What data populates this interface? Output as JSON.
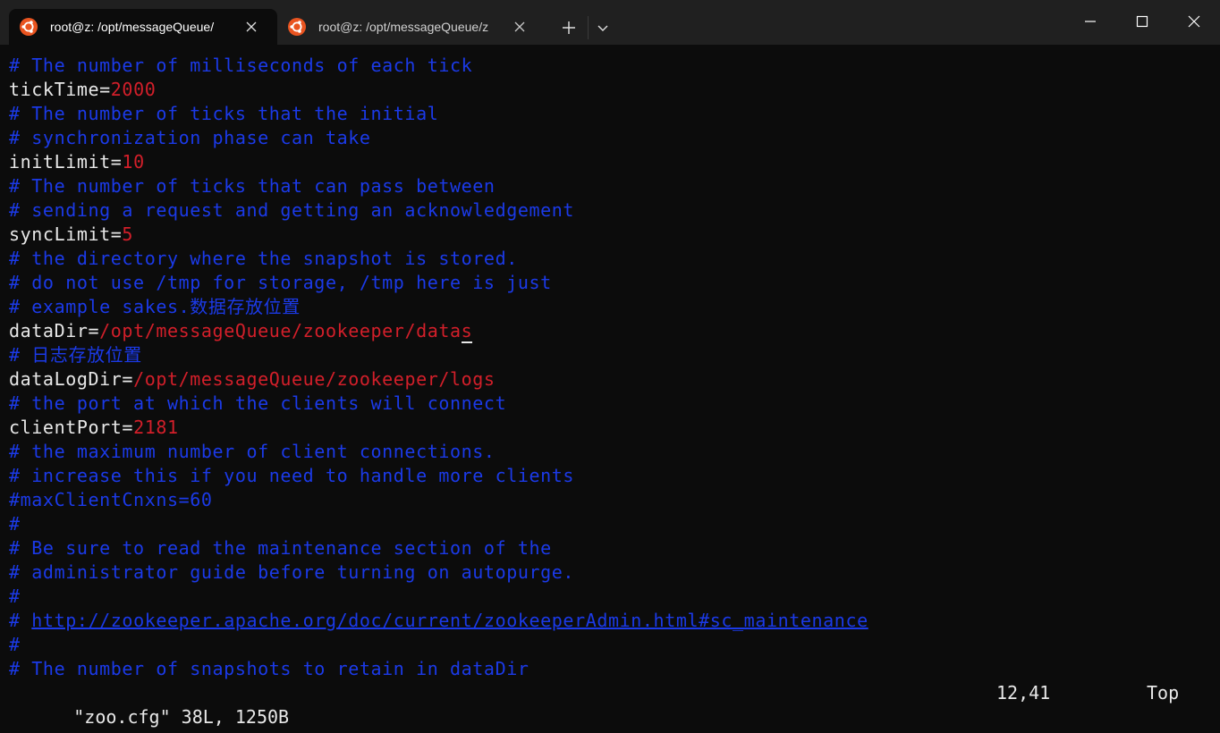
{
  "tabs": [
    {
      "label": "root@z: /opt/messageQueue/"
    },
    {
      "label": "root@z: /opt/messageQueue/z"
    }
  ],
  "colors": {
    "comment": "#1b3ae8",
    "text": "#e8e8e8",
    "value": "#d31f2a",
    "background": "#0c0c0c",
    "titlebar": "#202020",
    "ubuntu_orange": "#e95420"
  },
  "icons": {
    "tab": "ubuntu-icon",
    "close": "close-icon",
    "new_tab": "plus-icon",
    "dropdown": "chevron-down-icon",
    "minimize": "minimize-icon",
    "maximize": "maximize-icon",
    "window_close": "close-icon"
  },
  "editor": {
    "lines": [
      {
        "comment": "# The number of milliseconds of each tick"
      },
      {
        "key": "tickTime=",
        "value": "2000"
      },
      {
        "comment": "# The number of ticks that the initial"
      },
      {
        "comment": "# synchronization phase can take"
      },
      {
        "key": "initLimit=",
        "value": "10"
      },
      {
        "comment": "# The number of ticks that can pass between"
      },
      {
        "comment": "# sending a request and getting an acknowledgement"
      },
      {
        "key": "syncLimit=",
        "value": "5"
      },
      {
        "comment": "# the directory where the snapshot is stored."
      },
      {
        "comment": "# do not use /tmp for storage, /tmp here is just"
      },
      {
        "comment": "# example sakes.数据存放位置"
      },
      {
        "key": "dataDir=",
        "value": "/opt/messageQueue/zookeeper/data",
        "cursor_char": "s"
      },
      {
        "comment": "# 日志存放位置"
      },
      {
        "key": "dataLogDir=",
        "value": "/opt/messageQueue/zookeeper/logs"
      },
      {
        "comment": "# the port at which the clients will connect"
      },
      {
        "key": "clientPort=",
        "value": "2181"
      },
      {
        "comment": "# the maximum number of client connections."
      },
      {
        "comment": "# increase this if you need to handle more clients"
      },
      {
        "comment": "#maxClientCnxns=60"
      },
      {
        "comment": "#"
      },
      {
        "comment": "# Be sure to read the maintenance section of the"
      },
      {
        "comment": "# administrator guide before turning on autopurge."
      },
      {
        "comment": "#"
      },
      {
        "comment": "# ",
        "link": "http://zookeeper.apache.org/doc/current/zookeeperAdmin.html#sc_maintenance"
      },
      {
        "comment": "#"
      },
      {
        "comment": "# The number of snapshots to retain in dataDir"
      }
    ]
  },
  "status": {
    "file_info": "\"zoo.cfg\" 38L, 1250B",
    "cursor_position": "12,41",
    "scroll_position": "Top"
  }
}
